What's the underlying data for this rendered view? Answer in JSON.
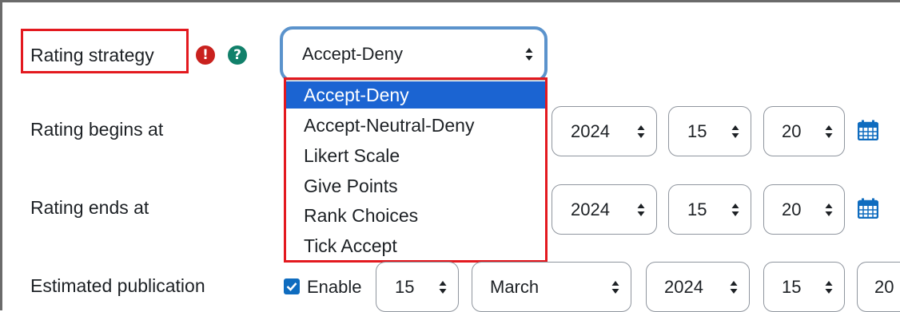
{
  "strategy": {
    "label": "Rating strategy",
    "error_icon": "exclamation-circle-icon",
    "help_icon": "question-circle-icon",
    "selected": "Accept-Deny",
    "options": [
      "Accept-Deny",
      "Accept-Neutral-Deny",
      "Likert Scale",
      "Give Points",
      "Rank Choices",
      "Tick Accept"
    ],
    "selected_index": 0
  },
  "rating_begins": {
    "label": "Rating begins at",
    "year": "2024",
    "hour": "15",
    "minute": "20",
    "calendar_icon": "calendar-icon"
  },
  "rating_ends": {
    "label": "Rating ends at",
    "year": "2024",
    "hour": "15",
    "minute": "20",
    "calendar_icon": "calendar-icon"
  },
  "publication": {
    "label": "Estimated publication",
    "enable_label": "Enable",
    "enable_checked": true,
    "day": "15",
    "month": "March",
    "year": "2024",
    "hour": "15",
    "minute": "20"
  },
  "colors": {
    "highlight": "#e3191f",
    "focus_border": "#5b93cc",
    "selected_option": "#1b64d2",
    "error": "#c9211e",
    "help": "#11806a",
    "calendar": "#0f6cbf"
  }
}
